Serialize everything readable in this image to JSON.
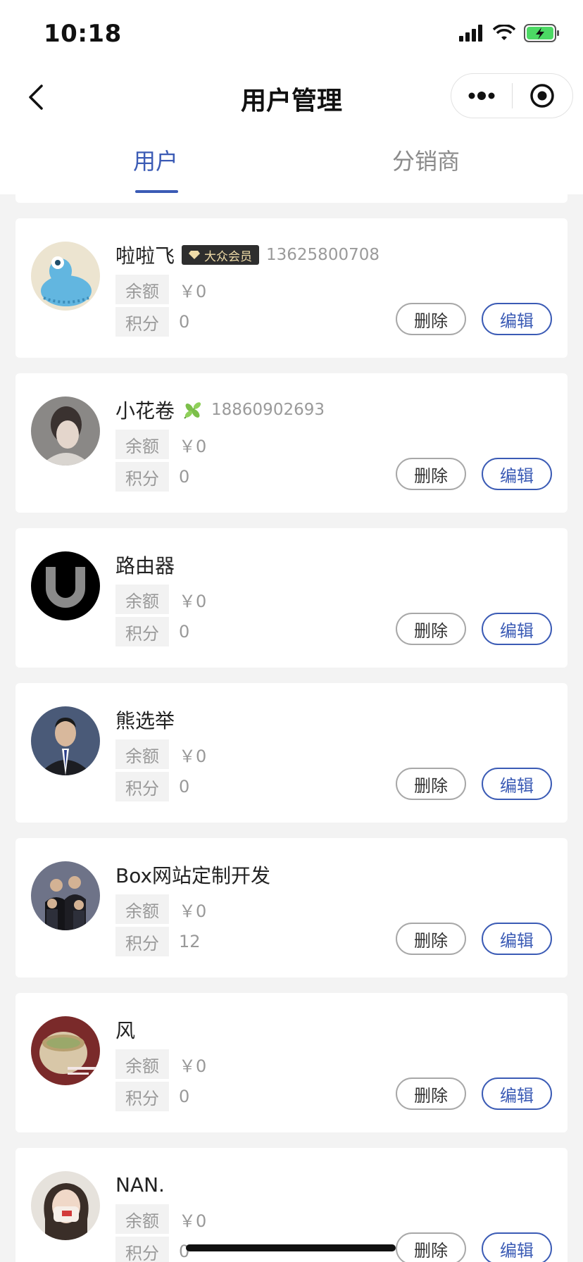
{
  "status_bar": {
    "time": "10:18"
  },
  "navbar": {
    "title": "用户管理",
    "more_icon": "more-dots-icon",
    "close_icon": "target-circle-icon"
  },
  "tabs": [
    {
      "label": "用户",
      "active": true
    },
    {
      "label": "分销商",
      "active": false
    }
  ],
  "colors": {
    "accent": "#3b5bb5",
    "badge_bg": "#2e2e2e",
    "badge_text": "#f0dca8"
  },
  "labels": {
    "balance": "余额",
    "points": "积分",
    "delete": "删除",
    "edit": "编辑"
  },
  "users": [
    {
      "name": "啦啦飞",
      "badge": "大众会员",
      "phone": "13625800708",
      "balance": "￥0",
      "points": "0"
    },
    {
      "name": "小花卷",
      "badge": "",
      "phone": "18860902693",
      "balance": "￥0",
      "points": "0",
      "emoji": "leaf"
    },
    {
      "name": "路由器",
      "badge": "",
      "phone": "",
      "balance": "￥0",
      "points": "0"
    },
    {
      "name": "熊选举",
      "badge": "",
      "phone": "",
      "balance": "￥0",
      "points": "0"
    },
    {
      "name": "Box网站定制开发",
      "badge": "",
      "phone": "",
      "balance": "￥0",
      "points": "12"
    },
    {
      "name": "风",
      "badge": "",
      "phone": "",
      "balance": "￥0",
      "points": "0"
    },
    {
      "name": "NAN.",
      "badge": "",
      "phone": "",
      "balance": "￥0",
      "points": "0"
    }
  ]
}
